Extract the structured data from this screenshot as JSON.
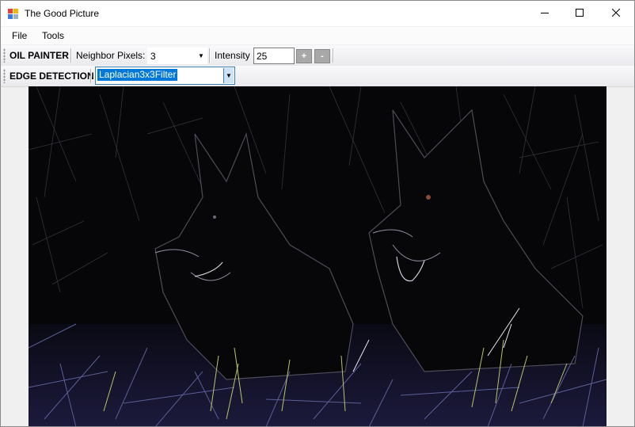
{
  "window": {
    "title": "The Good Picture",
    "icon": "app-picture-icon",
    "controls": [
      "minimize-icon",
      "maximize-icon",
      "close-icon"
    ]
  },
  "menu": {
    "items": [
      {
        "label": "File"
      },
      {
        "label": "Tools"
      }
    ]
  },
  "oil_painter": {
    "label": "OIL PAINTER",
    "neighbor_label": "Neighbor Pixels:",
    "neighbor_value": "3",
    "intensity_label": "Intensity",
    "intensity_value": "25",
    "plus_label": "+",
    "minus_label": "-"
  },
  "edge_detection": {
    "label": "EDGE DETECTION",
    "filter_value": "Laplacian3x3Filter"
  },
  "picture": {
    "icon": "image-canvas",
    "colors": {
      "background": "#050507",
      "edges": "#5b5f96",
      "grass": "#b9c46a"
    }
  }
}
